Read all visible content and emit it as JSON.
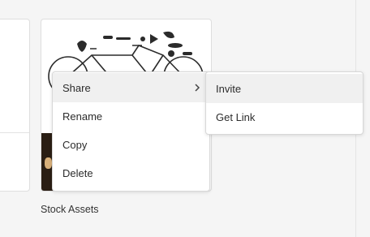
{
  "assets": {
    "card_title": "Stock Assets"
  },
  "context_menu": {
    "items": [
      {
        "label": "Share",
        "has_submenu": true
      },
      {
        "label": "Rename"
      },
      {
        "label": "Copy"
      },
      {
        "label": "Delete"
      }
    ],
    "submenu": {
      "items": [
        {
          "label": "Invite"
        },
        {
          "label": "Get Link"
        }
      ]
    }
  },
  "icons": {
    "submenu_indicator": "chevron-right-icon"
  },
  "colors": {
    "background": "#f5f5f5",
    "menu_background": "#ffffff",
    "hover_background": "#f0f0f0",
    "text": "#2c2c2c"
  }
}
